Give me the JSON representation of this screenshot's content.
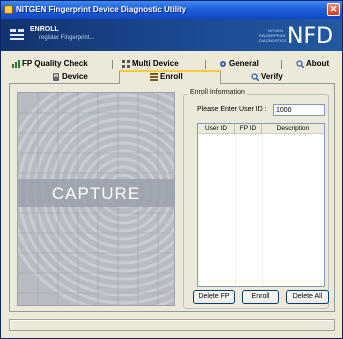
{
  "window": {
    "title": "NITGEN Fingerprint Device Diagnostic Utility",
    "close_glyph": "✕"
  },
  "banner": {
    "mode_title": "ENROLL",
    "mode_subtitle": "register Fingerprint...",
    "brand_small": "NITGEN FINGERPRINT DIAGNOSTICS",
    "brand": "NFD"
  },
  "tabs": {
    "row1": [
      {
        "label": "FP Quality Check",
        "icon": "quality-check-icon"
      },
      {
        "label": "Multi Device",
        "icon": "multi-device-icon"
      },
      {
        "label": "General",
        "icon": "general-icon"
      },
      {
        "label": "About",
        "icon": "about-icon"
      }
    ],
    "row2": [
      {
        "label": "Device",
        "icon": "device-icon"
      },
      {
        "label": "Enroll",
        "icon": "enroll-icon",
        "active": true
      },
      {
        "label": "Verify",
        "icon": "verify-icon"
      }
    ]
  },
  "capture": {
    "label": "CAPTURE"
  },
  "enroll": {
    "group_title": "Enroll Information",
    "userid_label": "Please Enter User ID :",
    "userid_value": "1000",
    "columns": [
      "User ID",
      "FP ID",
      "Description"
    ],
    "rows": [],
    "buttons": {
      "delete_fp": "Delete FP",
      "enroll": "Enroll",
      "delete_all": "Delete All"
    }
  },
  "statusbar": {
    "text": ""
  },
  "colors": {
    "titlebar": "#1f5fd8",
    "banner": "#1b4a93",
    "active_tab_accent": "#ffc83d",
    "capture_bg": "#b7bcc3"
  }
}
